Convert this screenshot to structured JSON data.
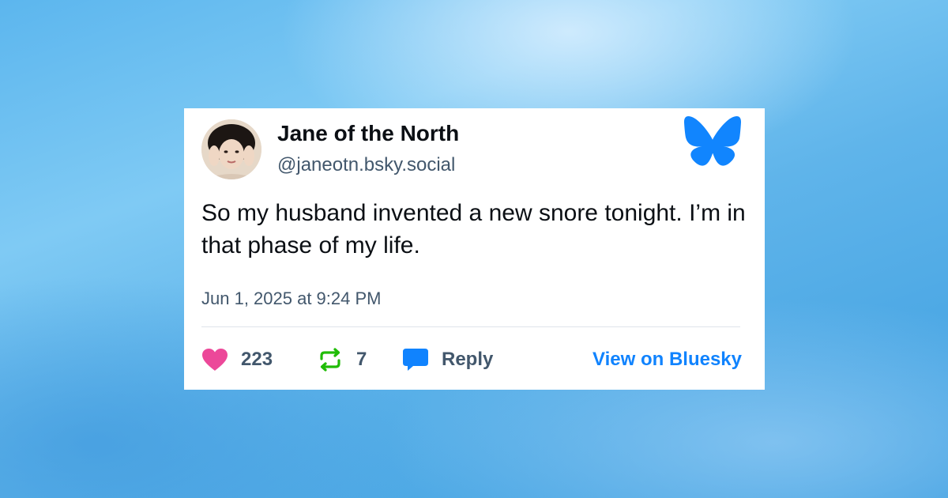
{
  "post": {
    "author": {
      "display_name": "Jane of the North",
      "handle": "@janeotn.bsky.social",
      "avatar_icon": "profile-photo"
    },
    "text": "So my husband invented a new snore tonight. I’m in that phase of my life.",
    "timestamp": "Jun 1, 2025 at 9:24 PM",
    "stats": {
      "likes": "223",
      "reposts": "7",
      "reply_label": "Reply"
    },
    "view_link_label": "View on Bluesky",
    "brand_icon": "bluesky-butterfly-icon"
  },
  "colors": {
    "like": "#ec4899",
    "repost": "#20bc07",
    "reply": "#1083fe",
    "link": "#1083fe",
    "brand": "#1185fe"
  }
}
